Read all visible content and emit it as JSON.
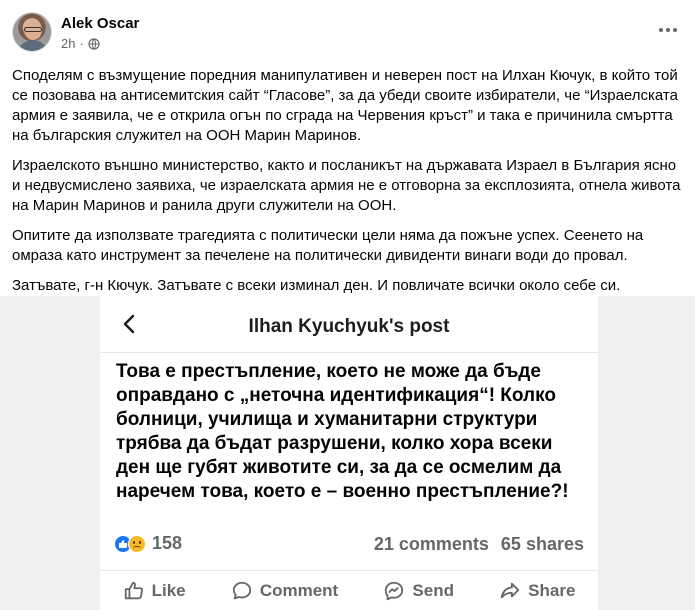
{
  "post": {
    "author": "Alek Oscar",
    "time": "2h",
    "paragraphs": [
      "Споделям с възмущение поредния манипулативен и неверен пост на Илхан Кючук, в който той се позовава на антисемитския сайт “Гласове”, за да убеди своите избиратели, че “Израелската армия е заявила, че е открила огън по сграда на Червения кръст” и така е причинила смъртта на българския служител на ООН Марин Маринов.",
      "Израелското външно министерство, както и посланикът на държавата Израел в България ясно и недвусмислено заявиха, че израелската армия не е отговорна за експлозията, отнела живота на Марин Маринов и ранила други служители на ООН.",
      "Опитите да използвате трагедията с политически цели няма да пожъне успех. Сеенето на омраза като инструмент за печелене на политически дивиденти винаги води до провал.",
      "Затъвате, г-н Кючук. Затъвате с всеки изминал ден. И повличате всички около себе си."
    ]
  },
  "embed": {
    "title": "Ilhan Kyuchyuk's post",
    "quote": "Това е престъпление, което не може да бъде оправдано с „неточна идентификация“! Колко болници, училища и хуманитарни структури трябва да бъдат разрушени, колко хора всеки ден ще губят животите си, за да се осмелим да наречем това, което е – военно престъпление?!",
    "reaction_count": "158",
    "comments": "21 comments",
    "shares": "65 shares",
    "actions": {
      "like": "Like",
      "comment": "Comment",
      "send": "Send",
      "share": "Share"
    }
  },
  "icons": {
    "privacy": "globe-icon",
    "more": "more-options-icon",
    "back": "chevron-left-icon"
  },
  "colors": {
    "accent": "#1877f2",
    "muted": "#65676b",
    "sad": "#f7b928"
  }
}
